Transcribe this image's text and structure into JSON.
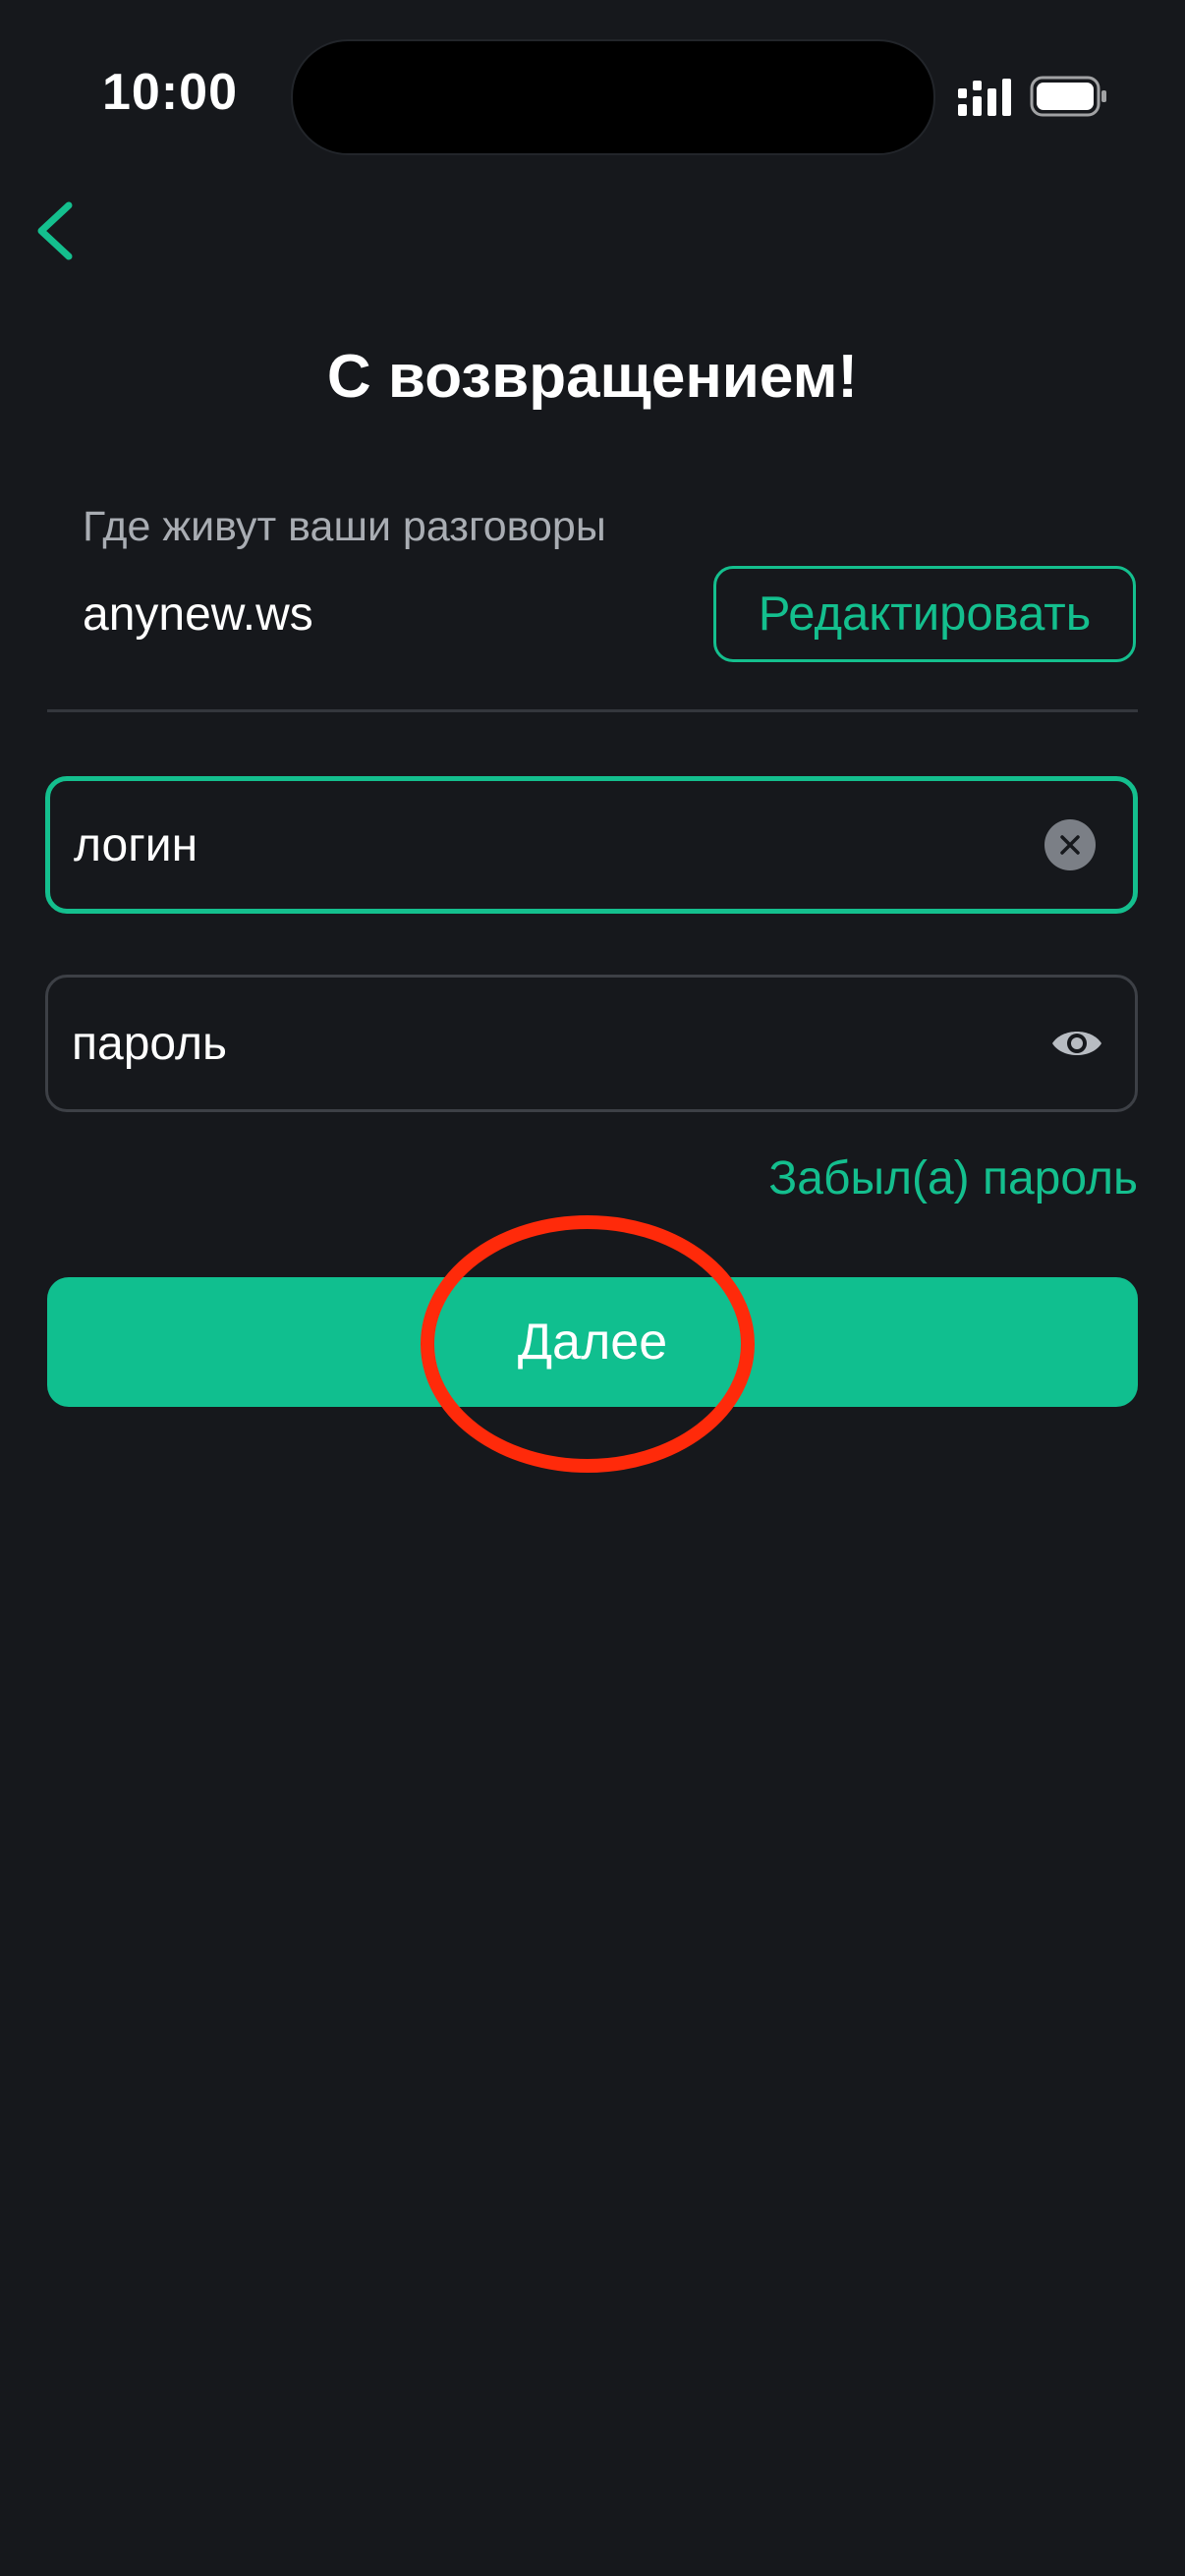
{
  "status_bar": {
    "time": "10:00"
  },
  "header": {
    "back_icon": "chevron-left-icon",
    "title": "С возвращением!"
  },
  "server": {
    "caption": "Где живут ваши разговоры",
    "value": "anynew.ws",
    "edit_label": "Редактировать"
  },
  "form": {
    "login_value": "логин",
    "login_clear_icon": "clear-icon",
    "password_value": "пароль",
    "password_toggle_icon": "eye-icon",
    "forgot_label": "Забыл(а) пароль",
    "next_label": "Далее"
  },
  "colors": {
    "background": "#16181c",
    "accent": "#14bf8e",
    "annotation": "#ff2a0a"
  }
}
